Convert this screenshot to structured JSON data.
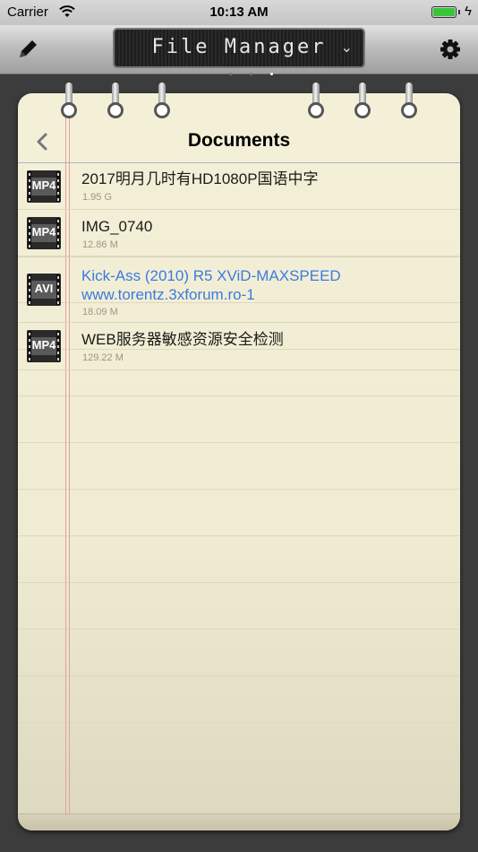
{
  "status": {
    "carrier": "Carrier",
    "time": "10:13 AM"
  },
  "toolbar": {
    "title": "File Manager",
    "chevron": "⌄"
  },
  "page": {
    "title": "Documents"
  },
  "files": [
    {
      "type": "MP4",
      "name": "2017明月几时有HD1080P国语中字",
      "size": "1.95 G",
      "highlight": false
    },
    {
      "type": "MP4",
      "name": "IMG_0740",
      "size": "12.86 M",
      "highlight": false
    },
    {
      "type": "AVI",
      "name": "Kick-Ass (2010) R5 XViD-MAXSPEED www.torentz.3xforum.ro-1",
      "size": "18.09 M",
      "highlight": true
    },
    {
      "type": "MP4",
      "name": "WEB服务器敏感资源安全检测",
      "size": "129.22 M",
      "highlight": false
    }
  ],
  "colors": {
    "link": "#3a7be0",
    "battery": "#3ac43a",
    "margin": "#e8a0a0"
  },
  "icons": [
    "wifi-icon",
    "battery-icon",
    "pencil-icon",
    "gear-icon",
    "chevron-left-icon",
    "video-file-icon"
  ]
}
